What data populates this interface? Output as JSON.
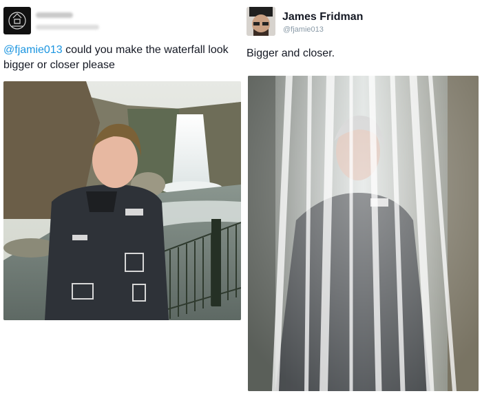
{
  "left_tweet": {
    "avatar_icon": "skull-emblem-icon",
    "mention": "@fjamie013",
    "text": " could you make the waterfall look bigger or closer please"
  },
  "right_tweet": {
    "author_name": "James Fridman",
    "author_handle": "@fjamie013",
    "reply_text": "Bigger and closer."
  },
  "colors": {
    "link": "#1b95e0",
    "text": "#141823",
    "handle": "#8899a6"
  }
}
